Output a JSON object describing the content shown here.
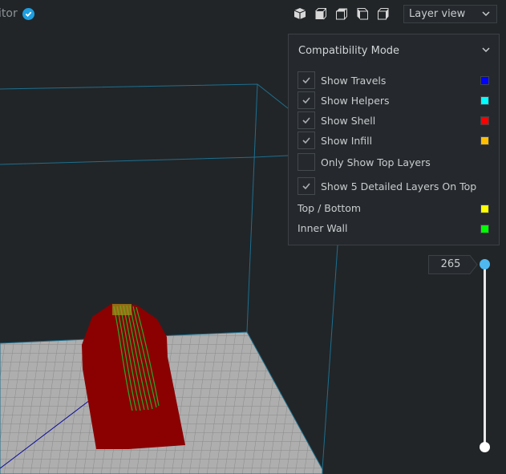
{
  "header": {
    "title_fragment": "itor",
    "verified_icon": "verified-check-icon",
    "view_buttons": [
      {
        "name": "3d-view-icon"
      },
      {
        "name": "front-view-icon"
      },
      {
        "name": "top-view-icon"
      },
      {
        "name": "left-view-icon"
      },
      {
        "name": "right-view-icon"
      }
    ],
    "view_mode": {
      "selected": "Layer view",
      "icon": "chevron-down-icon"
    }
  },
  "panel": {
    "title": "Compatibility Mode",
    "checkboxes": [
      {
        "label": "Show Travels",
        "checked": true,
        "color": "#0000ff"
      },
      {
        "label": "Show Helpers",
        "checked": true,
        "color": "#00ffff"
      },
      {
        "label": "Show Shell",
        "checked": true,
        "color": "#ff0000"
      },
      {
        "label": "Show Infill",
        "checked": true,
        "color": "#ffbf00"
      },
      {
        "label": "Only Show Top Layers",
        "checked": false
      },
      {
        "label": "Show 5 Detailed Layers On Top",
        "checked": true
      }
    ],
    "legend": [
      {
        "label": "Top / Bottom",
        "color": "#ffff00"
      },
      {
        "label": "Inner Wall",
        "color": "#00ff00"
      }
    ]
  },
  "layer_slider": {
    "current_layer": "265",
    "accent": "#4fb8f0"
  },
  "colors": {
    "background": "#212528",
    "build_volume_edge": "#1d6f8e",
    "bed": "#a8a8a8",
    "model_shell": "#8b0000",
    "infill": "#2aa02a"
  }
}
